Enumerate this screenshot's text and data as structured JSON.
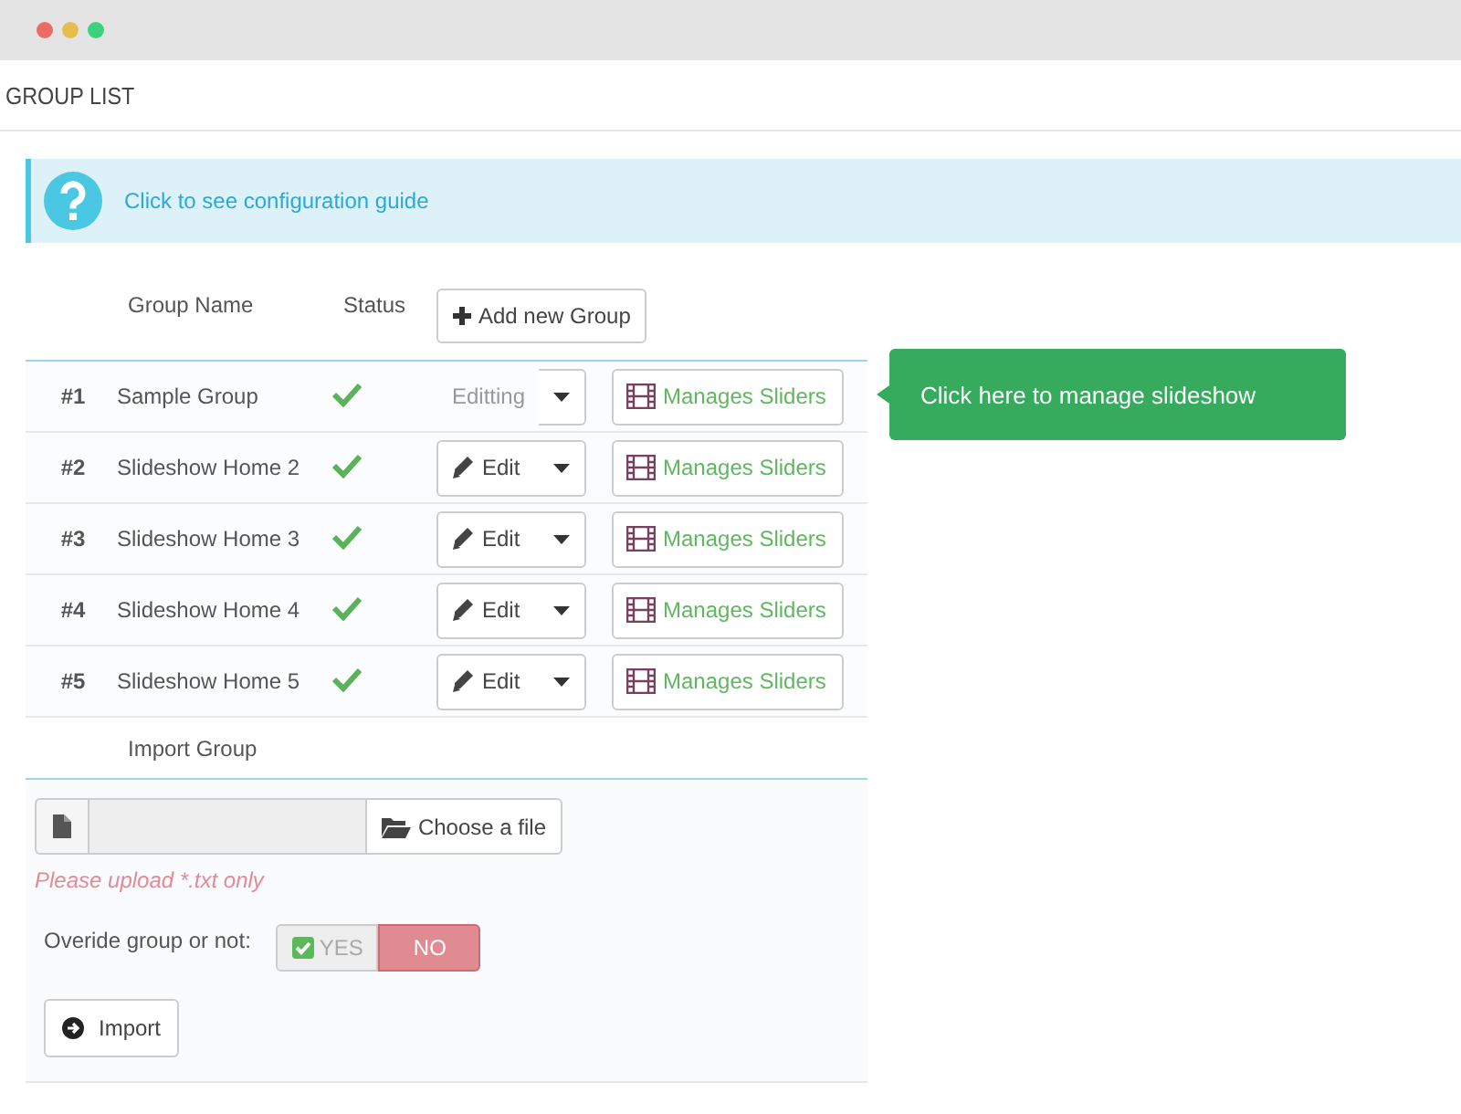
{
  "header": {
    "title": "GROUP LIST"
  },
  "info": {
    "text": "Click to see configuration guide"
  },
  "table": {
    "columns": [
      "Group Name",
      "Status"
    ],
    "add_button": "Add new Group",
    "rows": [
      {
        "index": "#1",
        "name": "Sample Group",
        "enabled": true,
        "editing": true,
        "edit_label": "Editting",
        "manage_label": "Manages Sliders"
      },
      {
        "index": "#2",
        "name": "Slideshow Home 2",
        "enabled": true,
        "editing": false,
        "edit_label": "Edit",
        "manage_label": "Manages Sliders"
      },
      {
        "index": "#3",
        "name": "Slideshow Home 3",
        "enabled": true,
        "editing": false,
        "edit_label": "Edit",
        "manage_label": "Manages Sliders"
      },
      {
        "index": "#4",
        "name": "Slideshow Home 4",
        "enabled": true,
        "editing": false,
        "edit_label": "Edit",
        "manage_label": "Manages Sliders"
      },
      {
        "index": "#5",
        "name": "Slideshow Home 5",
        "enabled": true,
        "editing": false,
        "edit_label": "Edit",
        "manage_label": "Manages Sliders"
      }
    ]
  },
  "import": {
    "heading": "Import Group",
    "choose_button": "Choose a file",
    "hint": "Please upload *.txt only",
    "override_label": "Overide group or not:",
    "toggle": [
      {
        "label": "YES",
        "selected": false
      },
      {
        "label": "NO",
        "selected": true
      }
    ],
    "import_button": "Import"
  },
  "tooltip": {
    "text": "Click here to manage slideshow"
  }
}
